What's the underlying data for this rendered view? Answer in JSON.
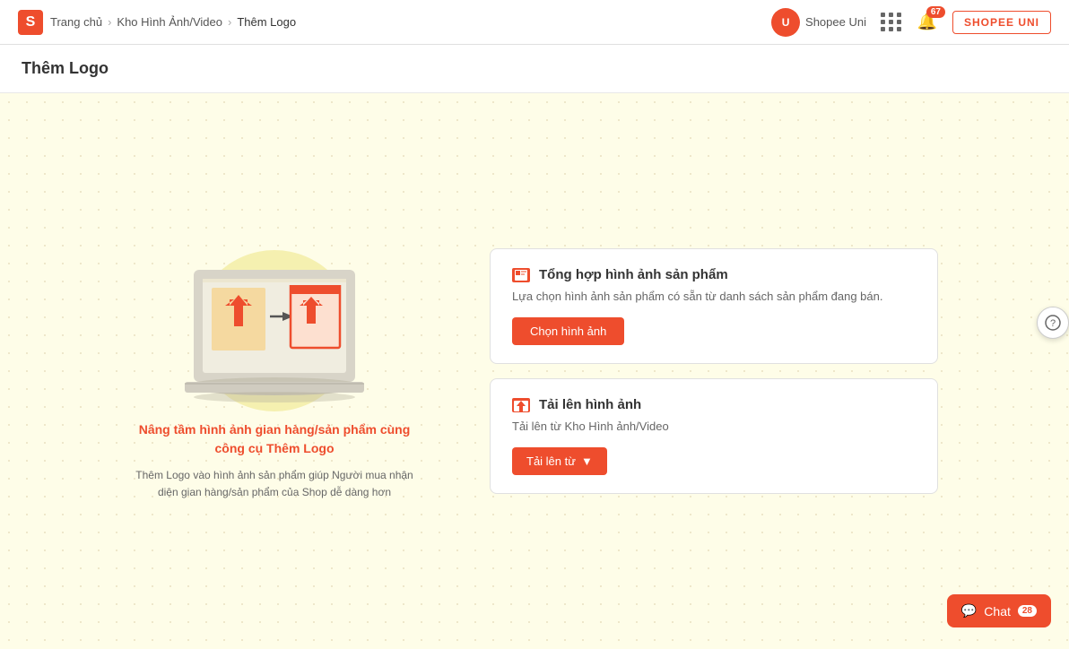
{
  "header": {
    "logo_text": "S",
    "breadcrumb": {
      "home": "Trang chủ",
      "middle": "Kho Hình Ảnh/Video",
      "current": "Thêm Logo"
    },
    "shopee_uni_label": "Shopee Uni",
    "notification_count": "67",
    "shopee_uni_btn": "SHOPEE UNI"
  },
  "page_title": "Thêm Logo",
  "main": {
    "promo_title": "Nâng tầm hình ảnh gian hàng/sản phẩm cùng công cụ Thêm Logo",
    "promo_desc": "Thêm Logo vào hình ảnh sản phẩm giúp Người mua nhận diện gian hàng/sản phẩm của Shop dễ dàng hơn",
    "card1": {
      "title": "Tổng hợp hình ảnh sản phẩm",
      "desc": "Lựa chọn hình ảnh sản phẩm có sẵn từ danh sách sản phẩm đang bán.",
      "btn": "Chọn hình ảnh"
    },
    "card2": {
      "title": "Tải lên hình ảnh",
      "desc": "Tải lên từ Kho Hình ảnh/Video",
      "btn": "Tải lên từ"
    }
  },
  "chat": {
    "label": "Chat",
    "badge": "28"
  }
}
